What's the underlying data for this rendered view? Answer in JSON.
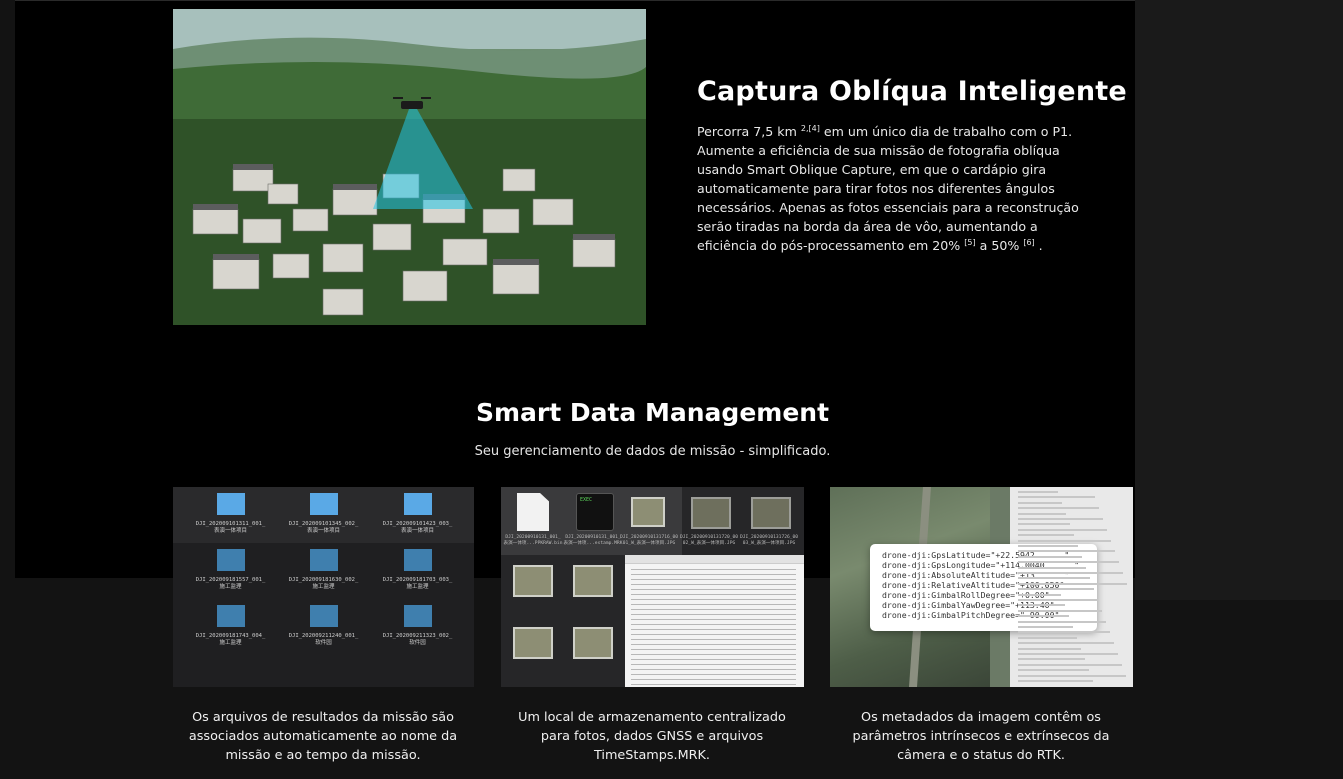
{
  "feature": {
    "title": "Captura Oblíqua Inteligente",
    "body_part1": "Percorra 7,5 km ",
    "sup1": "2,[4]",
    "body_part2": " em um único dia de trabalho com o P1. Aumente a eficiência de sua missão de fotografia oblíqua usando Smart Oblique Capture, em que o cardápio gira automaticamente para tirar fotos nos diferentes ângulos necessários. Apenas as fotos essenciais para a reconstrução serão tiradas na borda da área de vôo, aumentando a eficiência do pós-processamento em 20% ",
    "sup2": "[5]",
    "body_part3": " a 50% ",
    "sup3": "[6]",
    "body_part4": " ."
  },
  "section": {
    "title": "Smart Data Management",
    "subtitle": "Seu gerenciamento de dados de missão - simplificado."
  },
  "cards": [
    {
      "caption": "Os arquivos de resultados da missão são associados automaticamente ao nome da missão e ao tempo da missão.",
      "folders": [
        {
          "name": "DJI_202009101311_001_\n表演一体项目"
        },
        {
          "name": "DJI_202009101345_002_\n表演一体项目"
        },
        {
          "name": "DJI_202009101423_003_\n表演一体项目"
        },
        {
          "name": "DJI_202009181557_001_\n施工监理"
        },
        {
          "name": "DJI_202009181630_002_\n施工监理"
        },
        {
          "name": "DJI_202009181703_003_\n施工监理"
        },
        {
          "name": "DJI_202009181743_004_\n施工监理"
        },
        {
          "name": "DJI_202009211240_001_\n软件园"
        },
        {
          "name": "DJI_202009211323_002_\n软件园"
        }
      ]
    },
    {
      "caption": "Um local de armazenamento centralizado para fotos, dados GNSS e arquivos TimeStamps.MRK.",
      "exec_label": "exec",
      "files": [
        {
          "name": "DJI_20200910131_001_\n表演一体项...PPKRAW.bin"
        },
        {
          "name": "DJI_20200910131_001_\n表演一体项...estamp.MRK"
        },
        {
          "name": "DJI_20200910131716_00\n01_W_表演一体项目.JPG"
        },
        {
          "name": "DJI_20200910131720_00\n02_W_表演一体项目.JPG"
        },
        {
          "name": "DJI_20200910131726_00\n03_W_表演一体项目.JPG"
        }
      ]
    },
    {
      "caption": "Os metadados da imagem contêm os parâmetros intrínsecos e extrínsecos da câmera e o status do RTK.",
      "metadata": [
        "drone-dji:GpsLatitude=\"+22.5942      \"",
        "drone-dji:GpsLongitude=\"+114.0040      \"",
        "drone-dji:AbsoluteAltitude=\"+13      \"",
        "drone-dji:RelativeAltitude=\"+100.050\"",
        "drone-dji:GimbalRollDegree=\"+0.00\"",
        "drone-dji:GimbalYawDegree=\"+113.40\"",
        "drone-dji:GimbalPitchDegree=\"-90.00\""
      ]
    }
  ]
}
